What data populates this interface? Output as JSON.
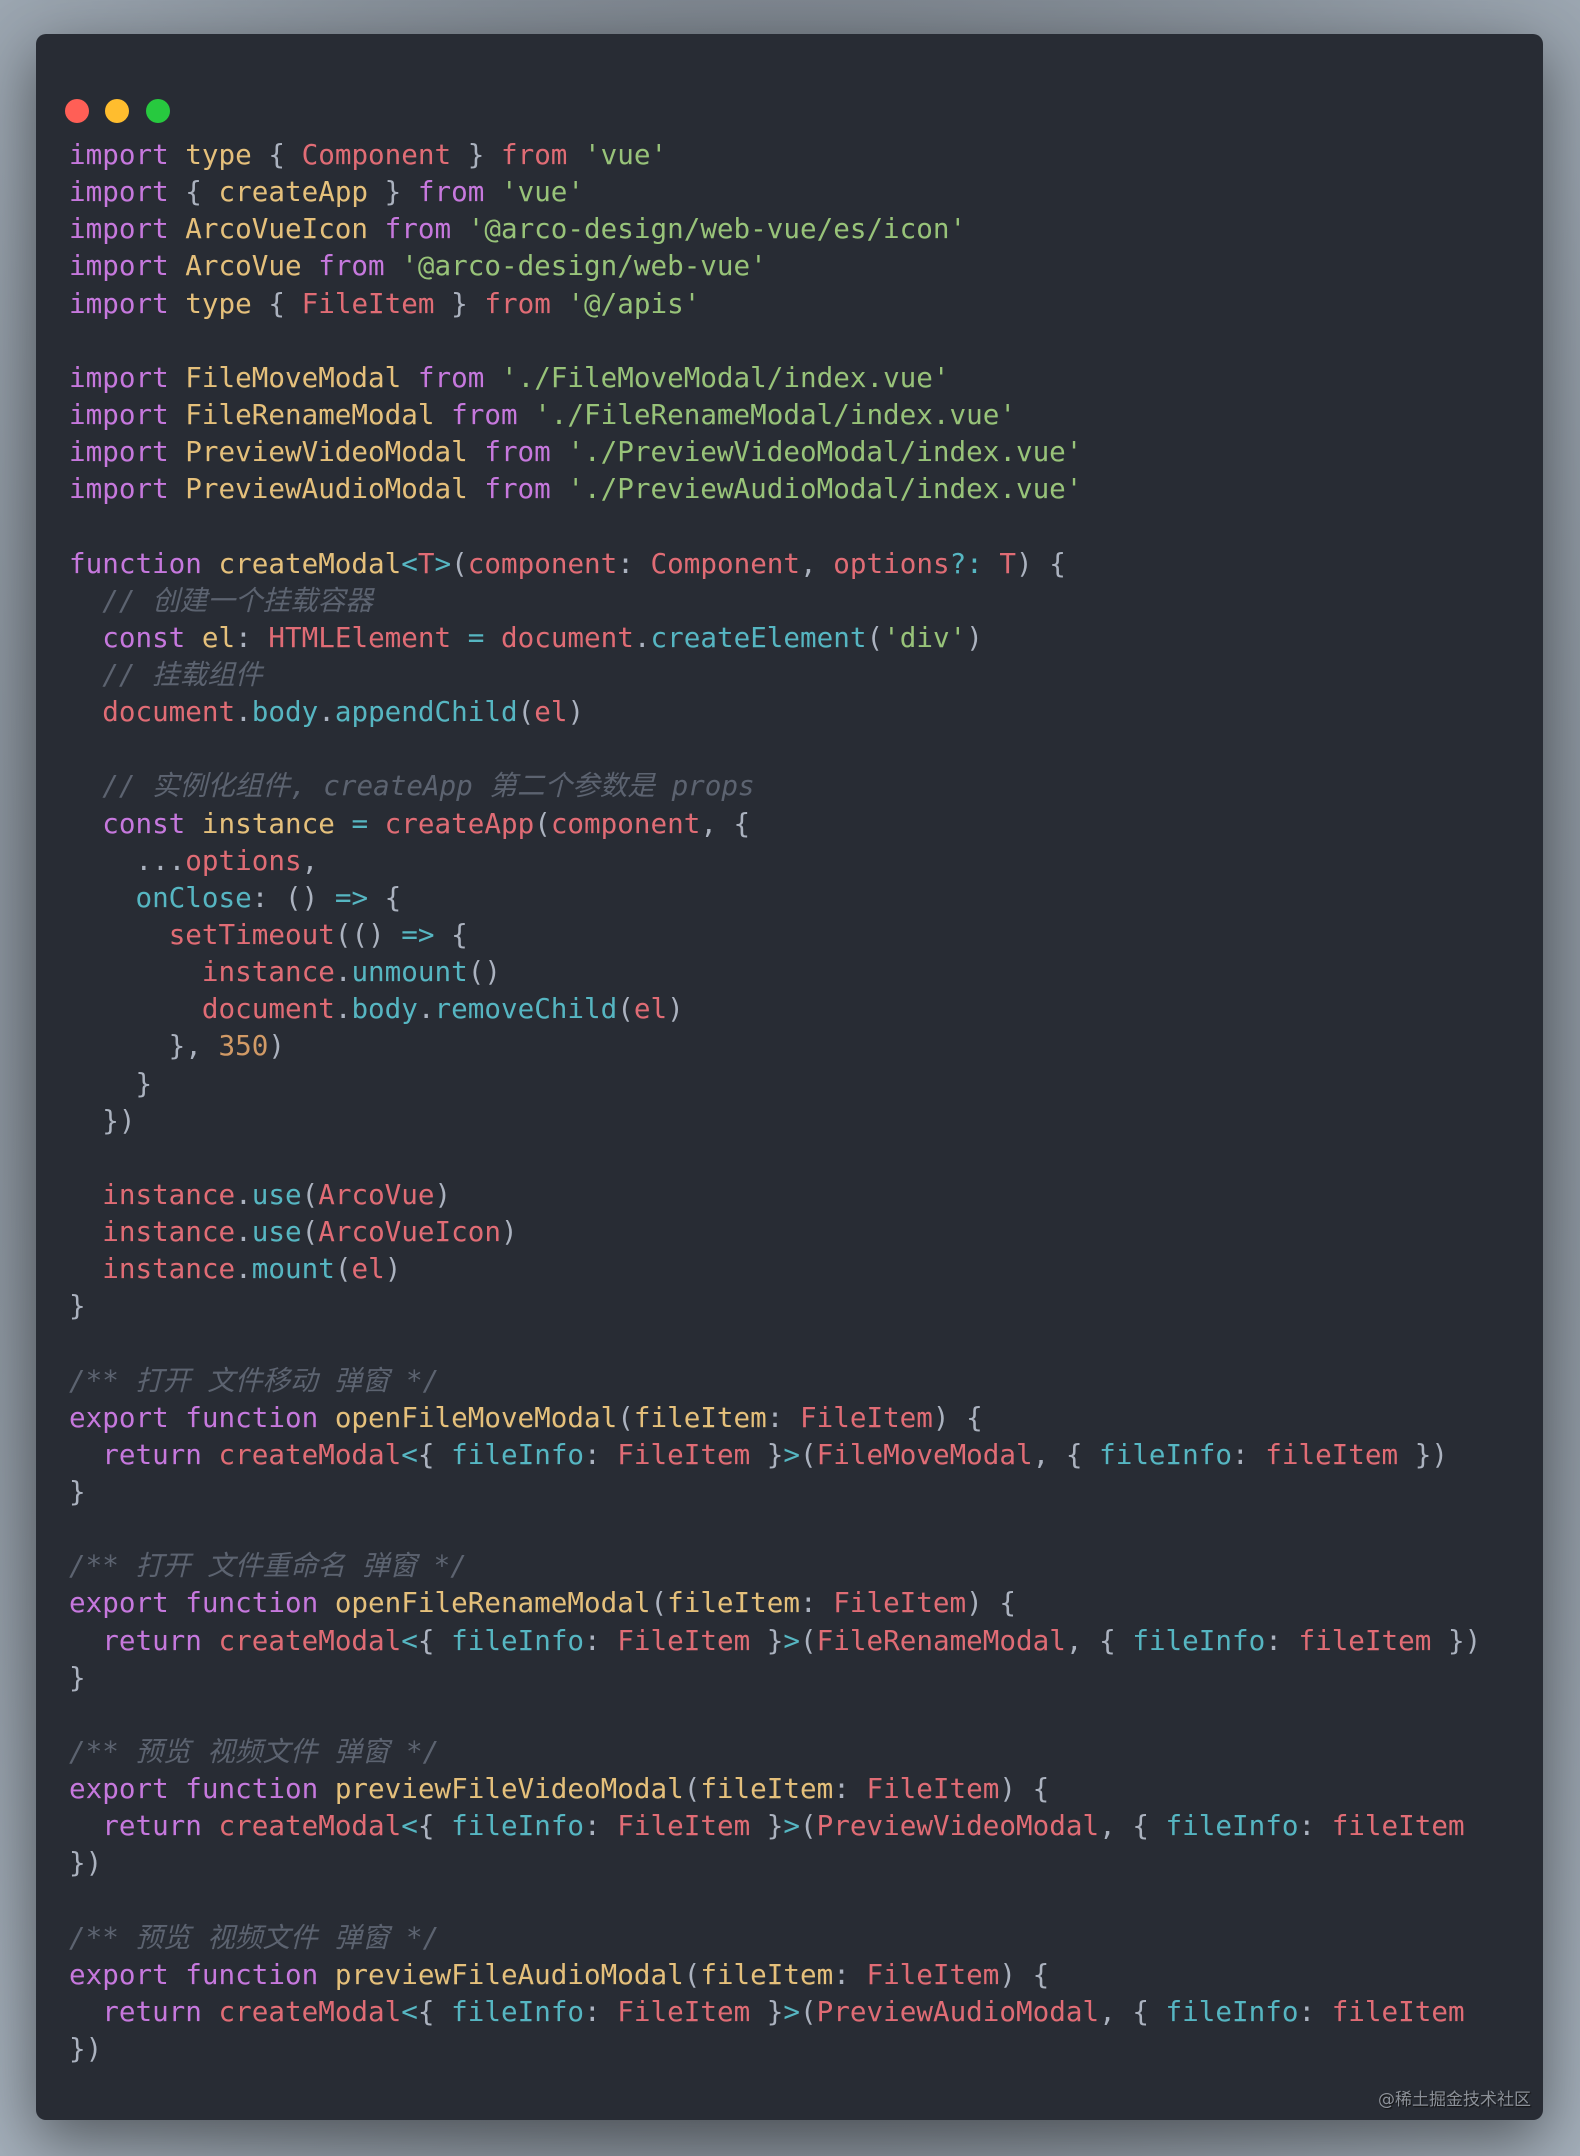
{
  "colors": {
    "keyword": "#c678dd",
    "function": "#e5c07b",
    "variable": "#e06c75",
    "string": "#98c379",
    "property": "#56b6c2",
    "punctuation": "#abb2bf",
    "number": "#d19a66",
    "comment": "#5c6370",
    "background": "#282c34"
  },
  "watermark": "@稀土掘金技术社区",
  "code_lines": [
    [
      [
        "import ",
        "k"
      ],
      [
        "type ",
        "f"
      ],
      [
        "{ ",
        "p"
      ],
      [
        "Component",
        "r"
      ],
      [
        " } ",
        "p"
      ],
      [
        "from ",
        "r"
      ],
      [
        "'vue'",
        "s"
      ]
    ],
    [
      [
        "import ",
        "k"
      ],
      [
        "{ ",
        "p"
      ],
      [
        "createApp",
        "f"
      ],
      [
        " } ",
        "p"
      ],
      [
        "from ",
        "k"
      ],
      [
        "'vue'",
        "s"
      ]
    ],
    [
      [
        "import ",
        "k"
      ],
      [
        "ArcoVueIcon ",
        "f"
      ],
      [
        "from ",
        "k"
      ],
      [
        "'@arco-design/web-vue/es/icon'",
        "s"
      ]
    ],
    [
      [
        "import ",
        "k"
      ],
      [
        "ArcoVue ",
        "f"
      ],
      [
        "from ",
        "k"
      ],
      [
        "'@arco-design/web-vue'",
        "s"
      ]
    ],
    [
      [
        "import ",
        "k"
      ],
      [
        "type ",
        "f"
      ],
      [
        "{ ",
        "p"
      ],
      [
        "FileItem",
        "r"
      ],
      [
        " } ",
        "p"
      ],
      [
        "from ",
        "r"
      ],
      [
        "'@/apis'",
        "s"
      ]
    ],
    [],
    [
      [
        "import ",
        "k"
      ],
      [
        "FileMoveModal ",
        "f"
      ],
      [
        "from ",
        "k"
      ],
      [
        "'./FileMoveModal/index.vue'",
        "s"
      ]
    ],
    [
      [
        "import ",
        "k"
      ],
      [
        "FileRenameModal ",
        "f"
      ],
      [
        "from ",
        "k"
      ],
      [
        "'./FileRenameModal/index.vue'",
        "s"
      ]
    ],
    [
      [
        "import ",
        "k"
      ],
      [
        "PreviewVideoModal ",
        "f"
      ],
      [
        "from ",
        "k"
      ],
      [
        "'./PreviewVideoModal/index.vue'",
        "s"
      ]
    ],
    [
      [
        "import ",
        "k"
      ],
      [
        "PreviewAudioModal ",
        "f"
      ],
      [
        "from ",
        "k"
      ],
      [
        "'./PreviewAudioModal/index.vue'",
        "s"
      ]
    ],
    [],
    [
      [
        "function ",
        "k"
      ],
      [
        "createModal",
        "f"
      ],
      [
        "<",
        "c"
      ],
      [
        "T",
        "r"
      ],
      [
        ">",
        "c"
      ],
      [
        "(",
        "p"
      ],
      [
        "component",
        "r"
      ],
      [
        ": ",
        "p"
      ],
      [
        "Component",
        "r"
      ],
      [
        ", ",
        "p"
      ],
      [
        "options",
        "r"
      ],
      [
        "?:",
        "c"
      ],
      [
        " ",
        "p"
      ],
      [
        "T",
        "r"
      ],
      [
        ") {",
        "p"
      ]
    ],
    [
      [
        "  ",
        "p"
      ],
      [
        "// 创建一个挂载容器",
        "m"
      ]
    ],
    [
      [
        "  ",
        "p"
      ],
      [
        "const ",
        "k"
      ],
      [
        "el",
        "f"
      ],
      [
        ": ",
        "p"
      ],
      [
        "HTMLElement ",
        "r"
      ],
      [
        "= ",
        "c"
      ],
      [
        "document",
        "r"
      ],
      [
        ".",
        "p"
      ],
      [
        "createElement",
        "c"
      ],
      [
        "(",
        "p"
      ],
      [
        "'div'",
        "s"
      ],
      [
        ")",
        "p"
      ]
    ],
    [
      [
        "  ",
        "p"
      ],
      [
        "// 挂载组件",
        "m"
      ]
    ],
    [
      [
        "  ",
        "p"
      ],
      [
        "document",
        "r"
      ],
      [
        ".",
        "p"
      ],
      [
        "body",
        "c"
      ],
      [
        ".",
        "p"
      ],
      [
        "appendChild",
        "c"
      ],
      [
        "(",
        "p"
      ],
      [
        "el",
        "r"
      ],
      [
        ")",
        "p"
      ]
    ],
    [],
    [
      [
        "  ",
        "p"
      ],
      [
        "// 实例化组件, createApp 第二个参数是 props",
        "m"
      ]
    ],
    [
      [
        "  ",
        "p"
      ],
      [
        "const ",
        "k"
      ],
      [
        "instance ",
        "f"
      ],
      [
        "= ",
        "c"
      ],
      [
        "createApp",
        "r"
      ],
      [
        "(",
        "p"
      ],
      [
        "component",
        "r"
      ],
      [
        ", {",
        "p"
      ]
    ],
    [
      [
        "    ...",
        "p"
      ],
      [
        "options",
        "r"
      ],
      [
        ",",
        "p"
      ]
    ],
    [
      [
        "    ",
        "p"
      ],
      [
        "onClose",
        "c"
      ],
      [
        ": () ",
        "p"
      ],
      [
        "=>",
        "c"
      ],
      [
        " {",
        "p"
      ]
    ],
    [
      [
        "      ",
        "p"
      ],
      [
        "setTimeout",
        "r"
      ],
      [
        "(() ",
        "p"
      ],
      [
        "=>",
        "c"
      ],
      [
        " {",
        "p"
      ]
    ],
    [
      [
        "        ",
        "p"
      ],
      [
        "instance",
        "r"
      ],
      [
        ".",
        "p"
      ],
      [
        "unmount",
        "c"
      ],
      [
        "()",
        "p"
      ]
    ],
    [
      [
        "        ",
        "p"
      ],
      [
        "document",
        "r"
      ],
      [
        ".",
        "p"
      ],
      [
        "body",
        "c"
      ],
      [
        ".",
        "p"
      ],
      [
        "removeChild",
        "c"
      ],
      [
        "(",
        "p"
      ],
      [
        "el",
        "r"
      ],
      [
        ")",
        "p"
      ]
    ],
    [
      [
        "      }, ",
        "p"
      ],
      [
        "350",
        "n"
      ],
      [
        ")",
        "p"
      ]
    ],
    [
      [
        "    }",
        "p"
      ]
    ],
    [
      [
        "  })",
        "p"
      ]
    ],
    [],
    [
      [
        "  ",
        "p"
      ],
      [
        "instance",
        "r"
      ],
      [
        ".",
        "p"
      ],
      [
        "use",
        "c"
      ],
      [
        "(",
        "p"
      ],
      [
        "ArcoVue",
        "r"
      ],
      [
        ")",
        "p"
      ]
    ],
    [
      [
        "  ",
        "p"
      ],
      [
        "instance",
        "r"
      ],
      [
        ".",
        "p"
      ],
      [
        "use",
        "c"
      ],
      [
        "(",
        "p"
      ],
      [
        "ArcoVueIcon",
        "r"
      ],
      [
        ")",
        "p"
      ]
    ],
    [
      [
        "  ",
        "p"
      ],
      [
        "instance",
        "r"
      ],
      [
        ".",
        "p"
      ],
      [
        "mount",
        "c"
      ],
      [
        "(",
        "p"
      ],
      [
        "el",
        "r"
      ],
      [
        ")",
        "p"
      ]
    ],
    [
      [
        "}",
        "p"
      ]
    ],
    [],
    [
      [
        "/** 打开 文件移动 弹窗 */",
        "m"
      ]
    ],
    [
      [
        "export ",
        "k"
      ],
      [
        "function ",
        "k"
      ],
      [
        "openFileMoveModal",
        "f"
      ],
      [
        "(",
        "p"
      ],
      [
        "fileItem",
        "f"
      ],
      [
        ": ",
        "p"
      ],
      [
        "FileItem",
        "r"
      ],
      [
        ") {",
        "p"
      ]
    ],
    [
      [
        "  ",
        "p"
      ],
      [
        "return ",
        "k"
      ],
      [
        "createModal",
        "r"
      ],
      [
        "<",
        "c"
      ],
      [
        "{ ",
        "p"
      ],
      [
        "fileInfo",
        "c"
      ],
      [
        ": ",
        "p"
      ],
      [
        "FileItem",
        "r"
      ],
      [
        " }",
        "p"
      ],
      [
        ">",
        "c"
      ],
      [
        "(",
        "p"
      ],
      [
        "FileMoveModal",
        "r"
      ],
      [
        ", { ",
        "p"
      ],
      [
        "fileInfo",
        "c"
      ],
      [
        ": ",
        "p"
      ],
      [
        "fileItem",
        "r"
      ],
      [
        " })",
        "p"
      ]
    ],
    [
      [
        "}",
        "p"
      ]
    ],
    [],
    [
      [
        "/** 打开 文件重命名 弹窗 */",
        "m"
      ]
    ],
    [
      [
        "export ",
        "k"
      ],
      [
        "function ",
        "k"
      ],
      [
        "openFileRenameModal",
        "f"
      ],
      [
        "(",
        "p"
      ],
      [
        "fileItem",
        "f"
      ],
      [
        ": ",
        "p"
      ],
      [
        "FileItem",
        "r"
      ],
      [
        ") {",
        "p"
      ]
    ],
    [
      [
        "  ",
        "p"
      ],
      [
        "return ",
        "k"
      ],
      [
        "createModal",
        "r"
      ],
      [
        "<",
        "c"
      ],
      [
        "{ ",
        "p"
      ],
      [
        "fileInfo",
        "c"
      ],
      [
        ": ",
        "p"
      ],
      [
        "FileItem",
        "r"
      ],
      [
        " }",
        "p"
      ],
      [
        ">",
        "c"
      ],
      [
        "(",
        "p"
      ],
      [
        "FileRenameModal",
        "r"
      ],
      [
        ", { ",
        "p"
      ],
      [
        "fileInfo",
        "c"
      ],
      [
        ": ",
        "p"
      ],
      [
        "fileItem",
        "r"
      ],
      [
        " })",
        "p"
      ]
    ],
    [
      [
        "}",
        "p"
      ]
    ],
    [],
    [
      [
        "/** 预览 视频文件 弹窗 */",
        "m"
      ]
    ],
    [
      [
        "export ",
        "k"
      ],
      [
        "function ",
        "k"
      ],
      [
        "previewFileVideoModal",
        "f"
      ],
      [
        "(",
        "p"
      ],
      [
        "fileItem",
        "f"
      ],
      [
        ": ",
        "p"
      ],
      [
        "FileItem",
        "r"
      ],
      [
        ") {",
        "p"
      ]
    ],
    [
      [
        "  ",
        "p"
      ],
      [
        "return ",
        "k"
      ],
      [
        "createModal",
        "r"
      ],
      [
        "<",
        "c"
      ],
      [
        "{ ",
        "p"
      ],
      [
        "fileInfo",
        "c"
      ],
      [
        ": ",
        "p"
      ],
      [
        "FileItem",
        "r"
      ],
      [
        " }",
        "p"
      ],
      [
        ">",
        "c"
      ],
      [
        "(",
        "p"
      ],
      [
        "PreviewVideoModal",
        "r"
      ],
      [
        ", { ",
        "p"
      ],
      [
        "fileInfo",
        "c"
      ],
      [
        ": ",
        "p"
      ],
      [
        "fileItem",
        "r"
      ]
    ],
    [
      [
        "})",
        "p"
      ]
    ],
    [],
    [
      [
        "/** 预览 视频文件 弹窗 */",
        "m"
      ]
    ],
    [
      [
        "export ",
        "k"
      ],
      [
        "function ",
        "k"
      ],
      [
        "previewFileAudioModal",
        "f"
      ],
      [
        "(",
        "p"
      ],
      [
        "fileItem",
        "f"
      ],
      [
        ": ",
        "p"
      ],
      [
        "FileItem",
        "r"
      ],
      [
        ") {",
        "p"
      ]
    ],
    [
      [
        "  ",
        "p"
      ],
      [
        "return ",
        "k"
      ],
      [
        "createModal",
        "r"
      ],
      [
        "<",
        "c"
      ],
      [
        "{ ",
        "p"
      ],
      [
        "fileInfo",
        "c"
      ],
      [
        ": ",
        "p"
      ],
      [
        "FileItem",
        "r"
      ],
      [
        " }",
        "p"
      ],
      [
        ">",
        "c"
      ],
      [
        "(",
        "p"
      ],
      [
        "PreviewAudioModal",
        "r"
      ],
      [
        ", { ",
        "p"
      ],
      [
        "fileInfo",
        "c"
      ],
      [
        ": ",
        "p"
      ],
      [
        "fileItem",
        "r"
      ]
    ],
    [
      [
        "})",
        "p"
      ]
    ]
  ]
}
